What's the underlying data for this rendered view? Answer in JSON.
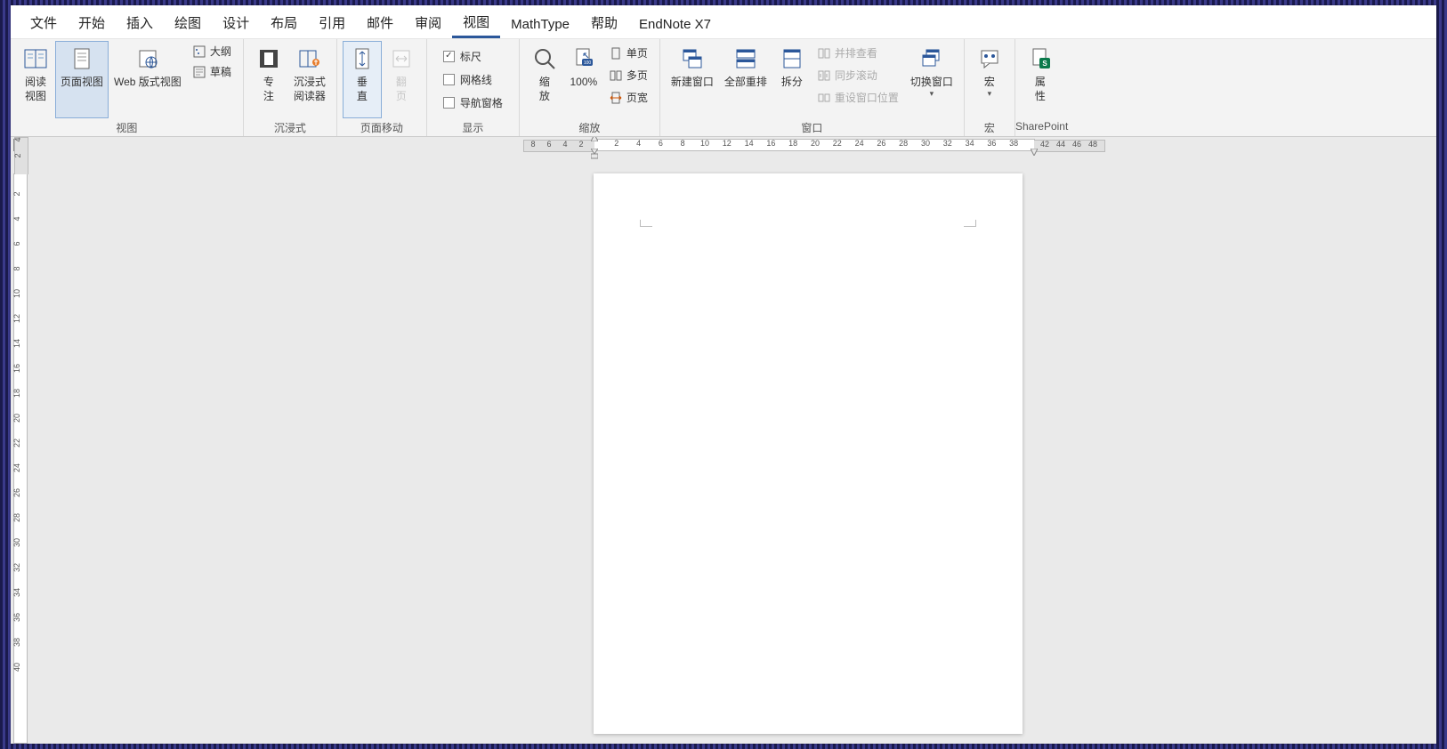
{
  "menu": {
    "items": [
      "文件",
      "开始",
      "插入",
      "绘图",
      "设计",
      "布局",
      "引用",
      "邮件",
      "审阅",
      "视图",
      "MathType",
      "帮助",
      "EndNote X7"
    ],
    "active_index": 9
  },
  "ribbon": {
    "groups": {
      "views": {
        "label": "视图",
        "reading_view": "阅读\n视图",
        "page_layout": "页面视图",
        "web_layout": "Web 版式视图",
        "outline": "大纲",
        "draft": "草稿"
      },
      "immersive": {
        "label": "沉浸式",
        "focus": "专\n注",
        "reader": "沉浸式\n阅读器"
      },
      "page_movement": {
        "label": "页面移动",
        "vertical": "垂\n直",
        "side_to_side": "翻\n页"
      },
      "show": {
        "label": "显示",
        "ruler": "标尺",
        "gridlines": "网格线",
        "nav_pane": "导航窗格",
        "ruler_checked": true,
        "gridlines_checked": false,
        "nav_checked": false
      },
      "zoom": {
        "label": "缩放",
        "zoom_btn": "缩\n放",
        "hundred": "100%",
        "one_page": "单页",
        "multi_page": "多页",
        "page_width": "页宽"
      },
      "window": {
        "label": "窗口",
        "new_window": "新建窗口",
        "arrange_all": "全部重排",
        "split": "拆分",
        "side_by_side": "并排查看",
        "sync_scroll": "同步滚动",
        "reset_pos": "重设窗口位置",
        "switch_windows": "切换窗口"
      },
      "macros": {
        "label": "宏",
        "macros_btn": "宏"
      },
      "sharepoint": {
        "label": "SharePoint",
        "properties": "属\n性"
      }
    }
  },
  "ruler": {
    "h_neg": [
      "8",
      "6",
      "4",
      "2"
    ],
    "h_pos": [
      "2",
      "4",
      "6",
      "8",
      "10",
      "12",
      "14",
      "16",
      "18",
      "20",
      "22",
      "24",
      "26",
      "28",
      "30",
      "32",
      "34",
      "36",
      "38"
    ],
    "h_extra": [
      "42",
      "44",
      "46",
      "48"
    ],
    "v_neg": [
      "4",
      "2"
    ],
    "v_pos": [
      "2",
      "4",
      "6",
      "8",
      "10",
      "12",
      "14",
      "16",
      "18",
      "20",
      "22",
      "24",
      "26",
      "28",
      "30",
      "32",
      "34",
      "36",
      "38",
      "40"
    ]
  }
}
